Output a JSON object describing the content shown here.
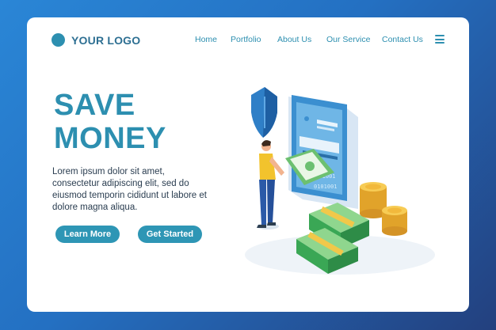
{
  "header": {
    "logo_text": "YOUR LOGO",
    "nav": [
      "Home",
      "Portfolio",
      "About Us",
      "Our Service",
      "Contact Us"
    ],
    "menu_icon": "hamburger-menu-icon"
  },
  "hero": {
    "title_line1": "SAVE",
    "title_line2": "MONEY",
    "description": "Lorem ipsum dolor sit amet, consectetur adipiscing elit, sed do eiusmod temporin cididunt ut labore et dolore magna aliqua.",
    "learn_more_label": "Learn More",
    "get_started_label": "Get Started"
  },
  "illustration": {
    "binary_text_1": "0101001",
    "binary_text_2": "0101001",
    "icons": [
      "shield-icon",
      "smartphone-icon",
      "banknote-icon",
      "coin-stack-icon",
      "person-icon"
    ]
  },
  "colors": {
    "accent": "#2d8fb0",
    "button": "#2e96b5",
    "background_start": "#2a86d6",
    "background_end": "#23407e"
  }
}
